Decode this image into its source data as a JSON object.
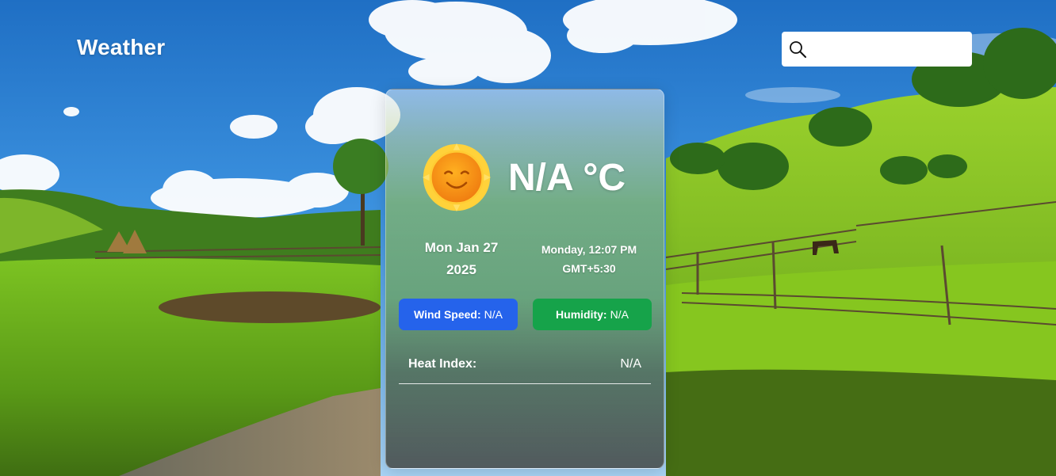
{
  "header": {
    "title": "Weather"
  },
  "search": {
    "placeholder": "",
    "value": "",
    "icon": "search-icon"
  },
  "weather_card": {
    "icon": "sun-icon",
    "temperature": "N/A °C",
    "date_line1": "Mon Jan 27",
    "date_line2": "2025",
    "time_line1": "Monday, 12:07 PM",
    "time_line2": "GMT+5:30",
    "wind": {
      "label": "Wind Speed:",
      "value": "N/A",
      "color": "#2563eb"
    },
    "humidity": {
      "label": "Humidity:",
      "value": "N/A",
      "color": "#16a34a"
    },
    "heat_index": {
      "label": "Heat Index:",
      "value": "N/A"
    }
  },
  "colors": {
    "sky": "#2f86d6",
    "grass": "#7cc322",
    "text": "#ffffff"
  }
}
